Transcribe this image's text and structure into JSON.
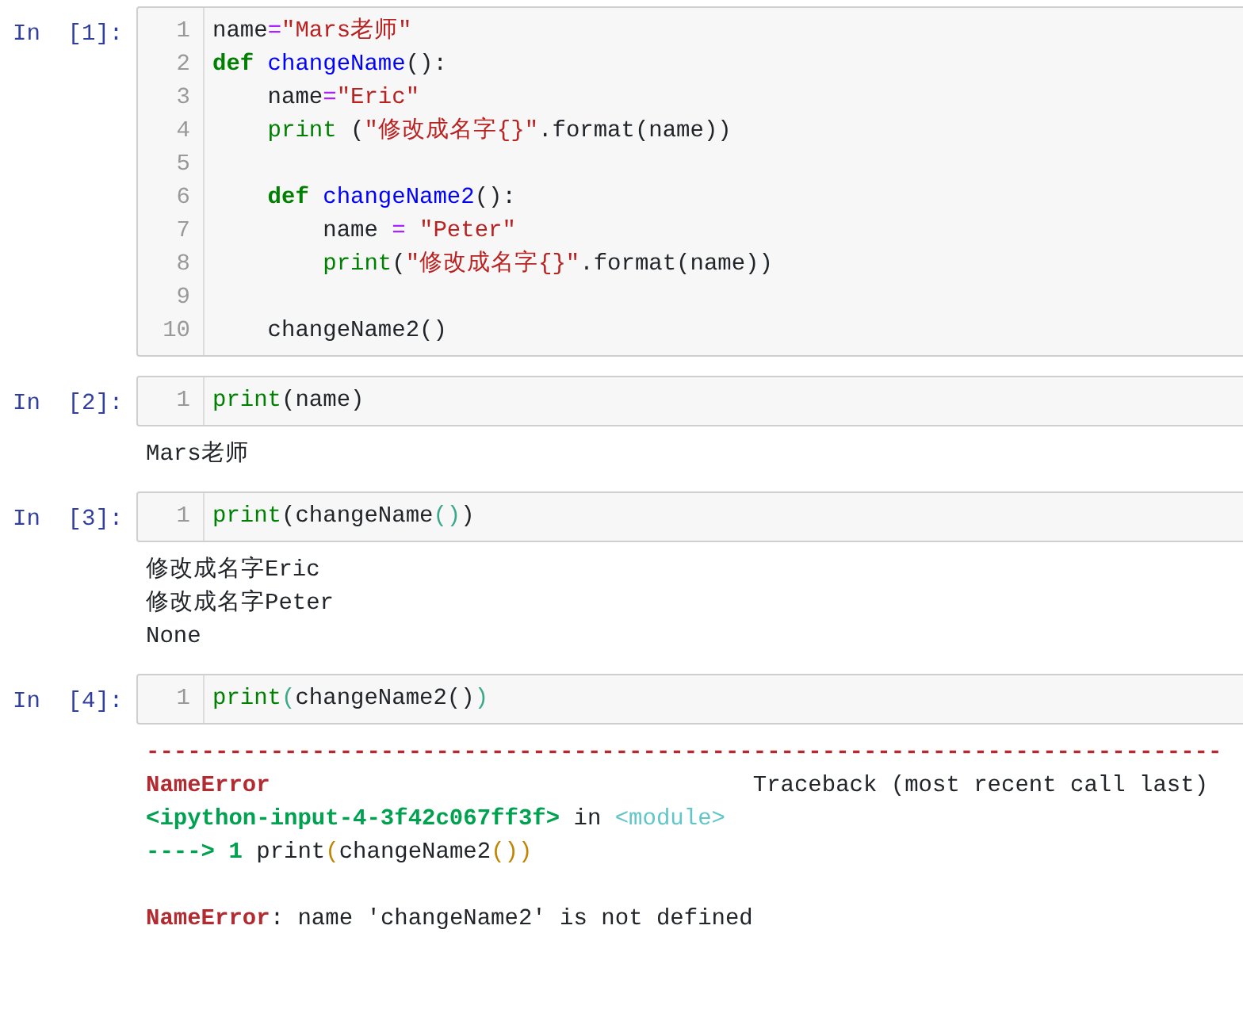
{
  "cells": [
    {
      "prompt": "In  [1]:",
      "lines": [
        {
          "number": "1",
          "tokens": [
            {
              "text": "name",
              "kind": "plain"
            },
            {
              "text": "=",
              "kind": "op"
            },
            {
              "text": "\"Mars老师\"",
              "kind": "str"
            }
          ]
        },
        {
          "number": "2",
          "tokens": [
            {
              "text": "def",
              "kind": "kw"
            },
            {
              "text": " changeName",
              "kind": "func"
            },
            {
              "text": "():",
              "kind": "plain"
            }
          ]
        },
        {
          "number": "3",
          "tokens": [
            {
              "text": "    name",
              "kind": "plain"
            },
            {
              "text": "=",
              "kind": "op"
            },
            {
              "text": "\"Eric\"",
              "kind": "str"
            }
          ]
        },
        {
          "number": "4",
          "tokens": [
            {
              "text": "    print",
              "kind": "builtin"
            },
            {
              "text": " (",
              "kind": "plain"
            },
            {
              "text": "\"修改成名字{}\"",
              "kind": "str"
            },
            {
              "text": ".format(name))",
              "kind": "plain"
            }
          ]
        },
        {
          "number": "5"
        },
        {
          "number": "6",
          "tokens": [
            {
              "text": "    def",
              "kind": "kw"
            },
            {
              "text": " changeName2",
              "kind": "func"
            },
            {
              "text": "():",
              "kind": "plain"
            }
          ]
        },
        {
          "number": "7",
          "tokens": [
            {
              "text": "        name ",
              "kind": "plain"
            },
            {
              "text": "=",
              "kind": "op"
            },
            {
              "text": " \"Peter\"",
              "kind": "str"
            }
          ]
        },
        {
          "number": "8",
          "tokens": [
            {
              "text": "        print",
              "kind": "builtin"
            },
            {
              "text": "(",
              "kind": "plain"
            },
            {
              "text": "\"修改成名字{}\"",
              "kind": "str"
            },
            {
              "text": ".format(name))",
              "kind": "plain"
            }
          ]
        },
        {
          "number": "9"
        },
        {
          "number": "10",
          "tokens": [
            {
              "text": "    changeName2()",
              "kind": "plain"
            }
          ]
        }
      ]
    },
    {
      "prompt": "In  [2]:",
      "lines": [
        {
          "number": "1",
          "tokens": [
            {
              "text": "print",
              "kind": "builtin"
            },
            {
              "text": "(name)",
              "kind": "plain"
            }
          ]
        }
      ],
      "outputs": [
        {
          "tokens": [
            {
              "text": "Mars老师",
              "kind": "plain"
            }
          ]
        }
      ]
    },
    {
      "prompt": "In  [3]:",
      "lines": [
        {
          "number": "1",
          "tokens": [
            {
              "text": "print",
              "kind": "builtin"
            },
            {
              "text": "(changeName",
              "kind": "plain"
            },
            {
              "text": "()",
              "kind": "match"
            },
            {
              "text": ")",
              "kind": "plain"
            }
          ]
        }
      ],
      "outputs": [
        {
          "tokens": [
            {
              "text": "修改成名字Eric",
              "kind": "plain"
            }
          ]
        },
        {
          "tokens": [
            {
              "text": "修改成名字Peter",
              "kind": "plain"
            }
          ]
        },
        {
          "tokens": [
            {
              "text": "None",
              "kind": "plain"
            }
          ]
        }
      ]
    },
    {
      "prompt": "In  [4]:",
      "lines": [
        {
          "number": "1",
          "tokens": [
            {
              "text": "print",
              "kind": "builtin"
            },
            {
              "text": "(",
              "kind": "match"
            },
            {
              "text": "changeName2()",
              "kind": "plain"
            },
            {
              "text": ")",
              "kind": "match"
            }
          ]
        }
      ],
      "outputs": [
        {
          "tokens": [
            {
              "text": "------------------------------------------------------------------------------",
              "kind": "err"
            }
          ]
        },
        {
          "tokens": [
            {
              "text": "NameError",
              "kind": "err"
            },
            {
              "text": "                                   Traceback (most recent call last)",
              "kind": "plain"
            }
          ]
        },
        {
          "tokens": [
            {
              "text": "<ipython-input-4-3f42c067ff3f>",
              "kind": "tbfile"
            },
            {
              "text": " in ",
              "kind": "plain"
            },
            {
              "text": "<module>",
              "kind": "tbmod"
            }
          ]
        },
        {
          "tokens": [
            {
              "text": "----> 1",
              "kind": "tbfile"
            },
            {
              "text": " print",
              "kind": "plain"
            },
            {
              "text": "(",
              "kind": "tbparen"
            },
            {
              "text": "changeName2",
              "kind": "plain"
            },
            {
              "text": "())",
              "kind": "tbparen"
            }
          ]
        },
        {
          "spaced": true,
          "tokens": [
            {
              "text": "NameError",
              "kind": "err"
            },
            {
              "text": ": name 'changeName2' is not defined",
              "kind": "plain"
            }
          ]
        }
      ]
    }
  ]
}
